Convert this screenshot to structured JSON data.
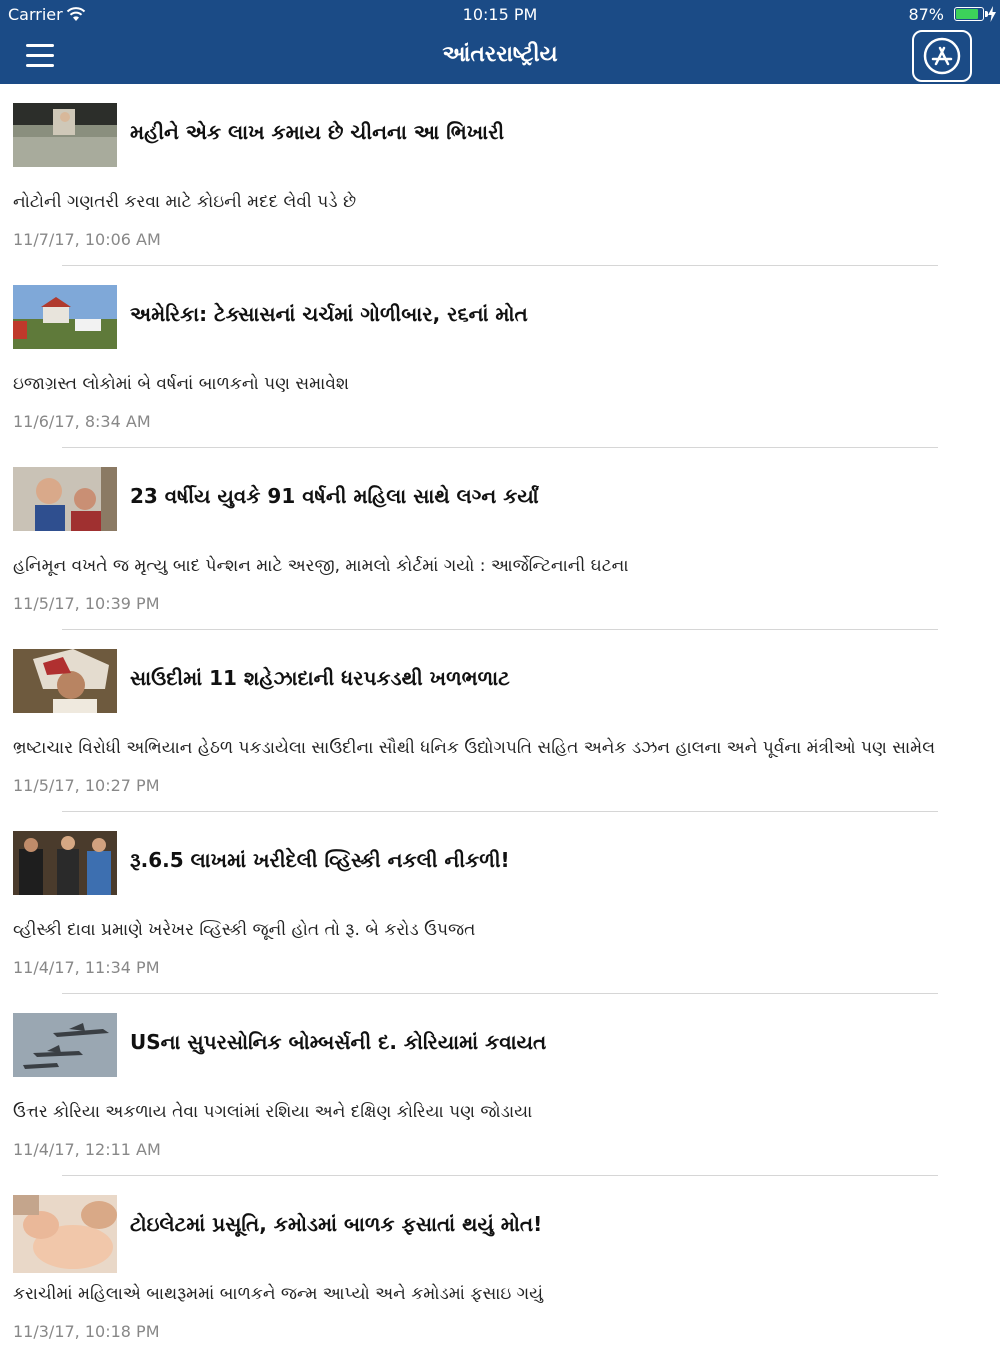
{
  "status_bar": {
    "carrier": "Carrier",
    "time": "10:15 PM",
    "battery": "87%",
    "battery_level": 0.87
  },
  "nav": {
    "title": "આંતરરાષ્ટ્રીય",
    "menu_icon": "hamburger-menu-icon",
    "right_icon": "app-store-icon"
  },
  "articles": [
    {
      "title": "મહીને એક લાખ કમાય છે ચીનના આ ભિખારી",
      "summary": "નોટોની ગણતરી કરવા માટે કોઇની મદદ લેવી પડે છે",
      "time": "11/7/17, 10:06 AM"
    },
    {
      "title": "અમેરિકા: ટેક્સાસનાં ચર્ચમાં ગોળીબાર, ર૬નાં મોત",
      "summary": "ઇજાગ્રસ્ત લોકોમાં બે વર્ષનાં બાળકનો પણ સમાવેશ",
      "time": "11/6/17, 8:34 AM"
    },
    {
      "title": "23 વર્ષીય યુવકે 91 વર્ષની મહિલા સાથે લગ્ન કર્યાં",
      "summary": "હનિમૂન વખતે જ મૃત્યુ બાદ પેન્શન માટે અરજી, મામલો કોર્ટમાં ગયો : આર્જેન્ટિનાની ઘટના",
      "time": "11/5/17, 10:39 PM"
    },
    {
      "title": "સાઉદીમાં 11 શહેઝાદાની ધરપકડથી ખળભળાટ",
      "summary": "ભ્રષ્ટાચાર વિરોધી અભિયાન હેઠળ પકડાયેલા સાઉદીના સૌથી ધનિક ઉદ્યોગપતિ સહિત અનેક ડઝન હાલના અને પૂર્વના મંત્રીઓ પણ સામેલ",
      "time": "11/5/17, 10:27 PM"
    },
    {
      "title": "રૂ.6.5 લાખમાં ખરીદેલી વ્હિસ્કી નકલી નીકળી!",
      "summary": "વ્હીસ્કી દાવા પ્રમાણે ખરેખર વ્હિસ્કી જૂની હોત તો રૂ. બે કરોડ ઉપજત",
      "time": "11/4/17, 11:34 PM"
    },
    {
      "title": "USના સુપરસોનિક બોમ્બર્સની દ. કોરિયામાં કવાયત",
      "summary": "ઉત્તર કોરિયા અકળાય તેવા પગલાંમાં રશિયા અને દક્ષિણ કોરિયા પણ જોડાયા",
      "time": "11/4/17, 12:11 AM"
    },
    {
      "title": "ટોઇલેટમાં પ્રસૂતિ, કમોડમાં બાળક ફસાતાં થયું મોત!",
      "summary": "કરાચીમાં મહિલાએ બાથરૂમમાં બાળકને જન્મ આપ્યો અને કમોડમાં ફસાઇ ગયું",
      "time": "11/3/17, 10:18 PM"
    }
  ]
}
